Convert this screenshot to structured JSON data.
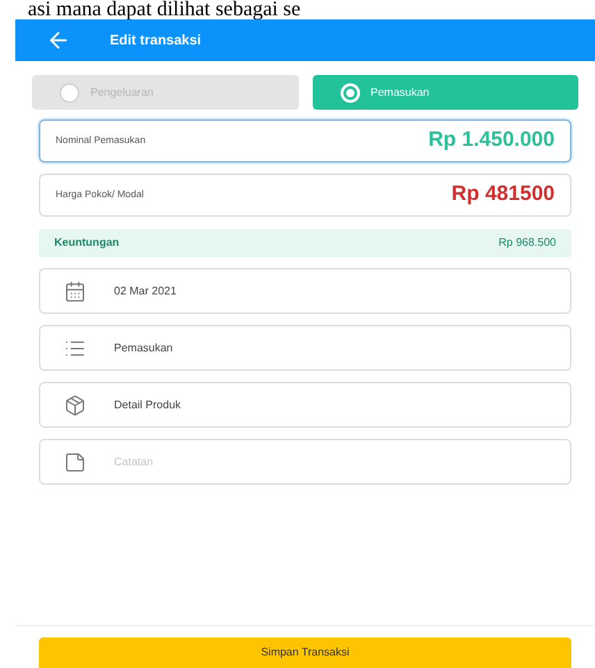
{
  "page_caption": "asi mana dapat dilihat sebagai se",
  "header": {
    "title": "Edit transaksi"
  },
  "type_options": [
    {
      "label": "Pengeluaran",
      "selected": false
    },
    {
      "label": "Pemasukan",
      "selected": true
    }
  ],
  "amounts": [
    {
      "label": "Nominal Pemasukan",
      "value": "Rp 1.450.000",
      "color": "#2bbf9a",
      "focused": true
    },
    {
      "label": "Harga Pokok/ Modal",
      "value": "Rp 481500",
      "color": "#d32f2f",
      "focused": false
    }
  ],
  "profit": {
    "label": "Keuntungan",
    "value": "Rp 968.500"
  },
  "fields": [
    {
      "kind": "date",
      "value": "02 Mar 2021"
    },
    {
      "kind": "category",
      "value": "Pemasukan"
    },
    {
      "kind": "product",
      "value": "Detail Produk"
    },
    {
      "kind": "note",
      "placeholder": "Catatan"
    }
  ],
  "save_button": "Simpan Transaksi"
}
